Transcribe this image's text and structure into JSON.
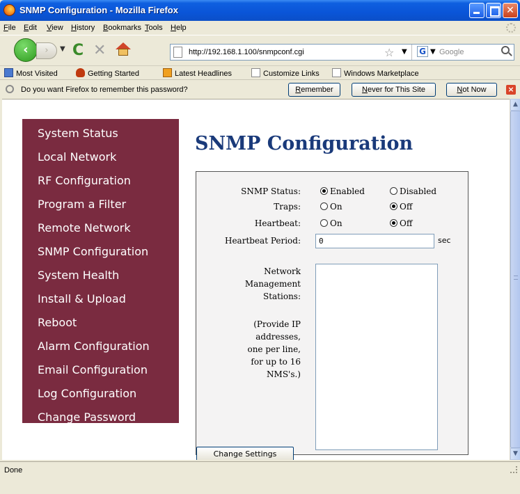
{
  "window": {
    "title": "SNMP Configuration - Mozilla Firefox"
  },
  "menu": {
    "items": [
      "File",
      "Edit",
      "View",
      "History",
      "Bookmarks",
      "Tools",
      "Help"
    ]
  },
  "navbar": {
    "url": "http://192.168.1.100/snmpconf.cgi",
    "search_placeholder": "Google"
  },
  "bookmarks": {
    "items": [
      "Most Visited",
      "Getting Started",
      "Latest Headlines",
      "Customize Links",
      "Windows Marketplace"
    ]
  },
  "notification": {
    "message": "Do you want Firefox to remember this password?",
    "remember": "Remember",
    "never": "Never for This Site",
    "not_now": "Not Now"
  },
  "sidebar": {
    "items": [
      "System Status",
      "Local Network",
      "RF Configuration",
      "Program a Filter",
      "Remote Network",
      "SNMP Configuration",
      "System Health",
      "Install & Upload",
      "Reboot",
      "Alarm Configuration",
      "Email Configuration",
      "Log Configuration",
      "Change Password"
    ]
  },
  "page": {
    "title": "SNMP Configuration"
  },
  "form": {
    "snmp_status_label": "SNMP Status:",
    "snmp_enabled": "Enabled",
    "snmp_disabled": "Disabled",
    "snmp_selected": "Enabled",
    "traps_label": "Traps:",
    "traps_on": "On",
    "traps_off": "Off",
    "traps_selected": "Off",
    "heartbeat_label": "Heartbeat:",
    "heartbeat_on": "On",
    "heartbeat_off": "Off",
    "heartbeat_selected": "Off",
    "heartbeat_period_label": "Heartbeat Period:",
    "heartbeat_period_value": "0",
    "heartbeat_period_unit": "sec",
    "nms_label_1": "Network",
    "nms_label_2": "Management",
    "nms_label_3": "Stations:",
    "help_1": "(Provide IP",
    "help_2": "addresses,",
    "help_3": "one per line,",
    "help_4": "for up to 16",
    "help_5": "NMS's.)",
    "nms_value": "",
    "submit": "Change Settings"
  },
  "status": {
    "text": "Done"
  }
}
